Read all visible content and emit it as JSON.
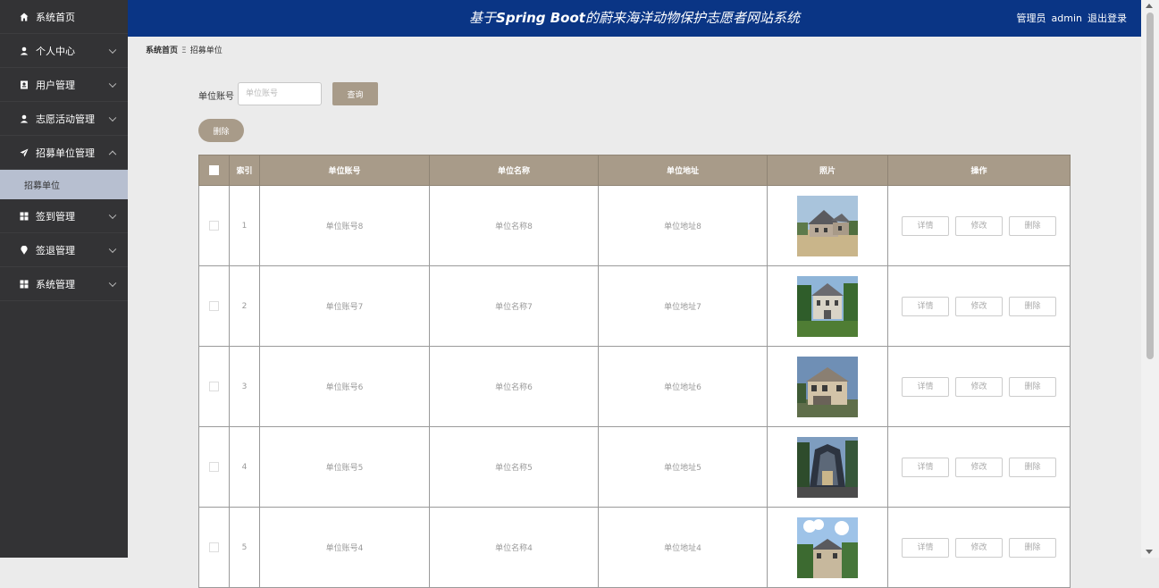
{
  "sidebar": {
    "items": [
      {
        "label": "系统首页",
        "icon": "home-icon",
        "chevron": false
      },
      {
        "label": "个人中心",
        "icon": "user-icon",
        "chevron": true
      },
      {
        "label": "用户管理",
        "icon": "id-card-icon",
        "chevron": true
      },
      {
        "label": "志愿活动管理",
        "icon": "user-icon",
        "chevron": true
      },
      {
        "label": "招募单位管理",
        "icon": "paper-plane-icon",
        "chevron": true,
        "expanded": true
      },
      {
        "label": "签到管理",
        "icon": "grid-icon",
        "chevron": true
      },
      {
        "label": "签退管理",
        "icon": "pin-icon",
        "chevron": true
      },
      {
        "label": "系统管理",
        "icon": "grid-icon",
        "chevron": true
      }
    ],
    "subitem": "招募单位"
  },
  "header": {
    "title_pre": "基于",
    "title_brand": "Spring Boot",
    "title_post": "的蔚来海洋动物保护志愿者网站系统",
    "user_role": "管理员",
    "username": "admin",
    "logout": "退出登录"
  },
  "breadcrumb": {
    "home": "系统首页",
    "current": "招募单位"
  },
  "search": {
    "label": "单位账号",
    "placeholder": "单位账号",
    "value": "",
    "button": "查询"
  },
  "actions": {
    "delete_batch": "删除"
  },
  "table": {
    "columns": [
      "",
      "索引",
      "单位账号",
      "单位名称",
      "单位地址",
      "照片",
      "操作"
    ],
    "rows": [
      {
        "index": "1",
        "account": "单位账号8",
        "name": "单位名称8",
        "address": "单位地址8"
      },
      {
        "index": "2",
        "account": "单位账号7",
        "name": "单位名称7",
        "address": "单位地址7"
      },
      {
        "index": "3",
        "account": "单位账号6",
        "name": "单位名称6",
        "address": "单位地址6"
      },
      {
        "index": "4",
        "account": "单位账号5",
        "name": "单位名称5",
        "address": "单位地址5"
      },
      {
        "index": "5",
        "account": "单位账号4",
        "name": "单位名称4",
        "address": "单位地址4"
      }
    ],
    "row_actions": {
      "detail": "详情",
      "edit": "修改",
      "delete": "删除"
    }
  },
  "colors": {
    "header_bg": "#0a3585",
    "sidebar_bg": "#333335",
    "accent": "#a89b89",
    "active_sub_bg": "#b7bfd0"
  }
}
